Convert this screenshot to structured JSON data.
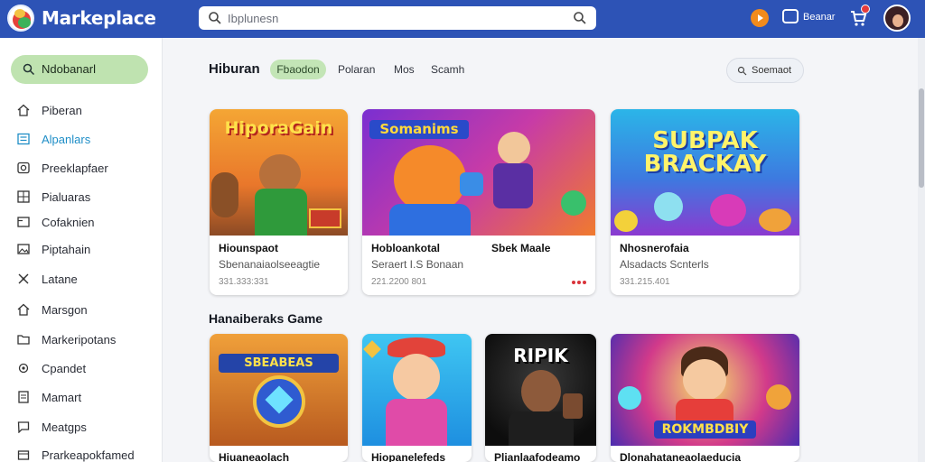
{
  "app": {
    "brand": "Markeplace"
  },
  "search": {
    "placeholder": "Ibplunesn"
  },
  "header": {
    "message_label": "Beanar"
  },
  "sidebar": {
    "active": "Ndobanarl",
    "items": [
      {
        "label": "Piberan",
        "icon": "home-icon"
      },
      {
        "label": "Alpanlars",
        "icon": "list-icon"
      },
      {
        "label": "Preeklapfaer",
        "icon": "camera-icon"
      },
      {
        "label": "Pialuaras",
        "icon": "grid-icon"
      },
      {
        "label": "Cofaknien",
        "icon": "card-icon"
      },
      {
        "label": "Piptahain",
        "icon": "image-icon"
      },
      {
        "label": "Latane",
        "icon": "tools-icon"
      },
      {
        "label": "Marsgon",
        "icon": "home-icon"
      },
      {
        "label": "Markeripotans",
        "icon": "folder-icon"
      },
      {
        "label": "Cpandet",
        "icon": "gear-icon"
      },
      {
        "label": "Mamart",
        "icon": "doc-icon"
      },
      {
        "label": "Meatgps",
        "icon": "chat-icon"
      },
      {
        "label": "Prarkeapokfamed",
        "icon": "box-icon"
      }
    ]
  },
  "main": {
    "title": "Hiburan",
    "chip": "Fbaodon",
    "tabs": [
      "Polaran",
      "Mos",
      "Scamh"
    ],
    "suggest_button": "Soemaot",
    "section2_title": "Hanaiberaks Game",
    "row1": [
      {
        "art_text": "HiporaGain",
        "title": "Hiounspaot",
        "subtitle": "Sbenanaiaolseeagtie",
        "meta": "331.333:331"
      },
      {
        "art_text": "Somanims",
        "title": "Hobloankotal",
        "title_right": "Sbek Maale",
        "subtitle": "Seraert I.S Bonaan",
        "meta": "221.2200 801"
      },
      {
        "art_text": "SUBPAK BRACKAY",
        "title": "Nhosnerofaia",
        "subtitle": "Alsadacts Scnterls",
        "meta": "331.215.401"
      }
    ],
    "row2": [
      {
        "art_text": "SBEABEAS",
        "title": "Hiuaneaolach"
      },
      {
        "art_text": "",
        "title": "Hiopanelefeds"
      },
      {
        "art_text": "RIPIK",
        "title": "Plianlaafodeamo"
      },
      {
        "art_text": "ROKMBDBIY",
        "title": "Dlonahataneaolaeducia"
      }
    ]
  }
}
